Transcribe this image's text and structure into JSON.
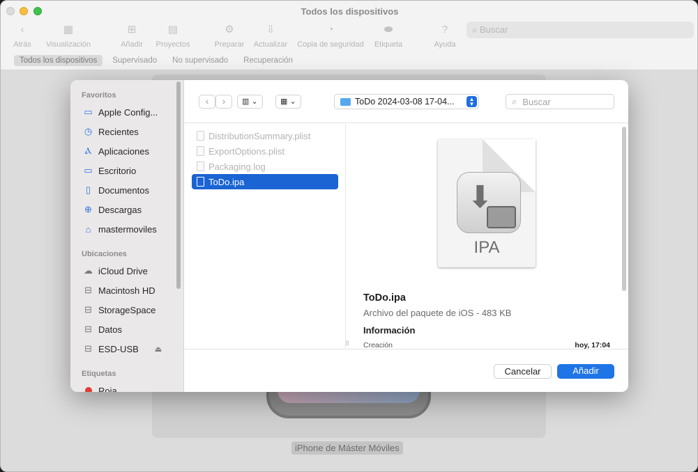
{
  "window": {
    "title": "Todos los dispositivos",
    "toolbar": [
      {
        "icon": "back-chevron-icon",
        "glyph": "‹",
        "label": "Atrás"
      },
      {
        "icon": "view-grid-icon",
        "glyph": "▦",
        "label": "Visualización"
      },
      {
        "icon": "plus-icon",
        "glyph": "⊞",
        "label": "Añadir"
      },
      {
        "icon": "blueprint-icon",
        "glyph": "▤",
        "label": "Proyectos"
      },
      {
        "icon": "prepare-icon",
        "glyph": "⚙",
        "label": "Preparar"
      },
      {
        "icon": "update-icon",
        "glyph": "⇩",
        "label": "Actualizar"
      },
      {
        "icon": "backup-icon",
        "glyph": "◔",
        "label": "Copia de seguridad"
      },
      {
        "icon": "tag-icon",
        "glyph": "⬬",
        "label": "Etiqueta"
      },
      {
        "icon": "help-icon",
        "glyph": "?",
        "label": "Ayuda"
      }
    ],
    "search_placeholder": "Buscar",
    "filters": [
      "Todos los dispositivos",
      "Supervisado",
      "No supervisado",
      "Recuperación"
    ],
    "device_name": "iPhone de Máster Móviles"
  },
  "dialog": {
    "sidebar": {
      "favorites_header": "Favoritos",
      "favorites": [
        {
          "label": "Apple Config...",
          "icon": "folder-icon",
          "glyph": "▭"
        },
        {
          "label": "Recientes",
          "icon": "clock-icon",
          "glyph": "◷"
        },
        {
          "label": "Aplicaciones",
          "icon": "applications-icon",
          "glyph": "Ⲁ"
        },
        {
          "label": "Escritorio",
          "icon": "desktop-icon",
          "glyph": "▭"
        },
        {
          "label": "Documentos",
          "icon": "document-icon",
          "glyph": "▯"
        },
        {
          "label": "Descargas",
          "icon": "download-icon",
          "glyph": "⊕"
        },
        {
          "label": "mastermoviles",
          "icon": "home-icon",
          "glyph": "⌂"
        }
      ],
      "locations_header": "Ubicaciones",
      "locations": [
        {
          "label": "iCloud Drive",
          "icon": "cloud-icon",
          "glyph": "☁"
        },
        {
          "label": "Macintosh HD",
          "icon": "drive-icon",
          "glyph": "⊟"
        },
        {
          "label": "StorageSpace",
          "icon": "drive-icon",
          "glyph": "⊟"
        },
        {
          "label": "Datos",
          "icon": "drive-icon",
          "glyph": "⊟"
        },
        {
          "label": "ESD-USB",
          "icon": "drive-icon",
          "glyph": "⊟"
        }
      ],
      "eject_glyph": "⏏",
      "tags_header": "Etiquetas",
      "tags": [
        {
          "label": "Roja",
          "color": "#e53935"
        }
      ]
    },
    "toolbar": {
      "back_glyph": "‹",
      "forward_glyph": "›",
      "view_mode": "▥ ⌄",
      "group_mode": "▦ ⌄",
      "location": "ToDo 2024-03-08 17-04...",
      "search_placeholder": "Buscar"
    },
    "files": [
      {
        "name": "DistributionSummary.plist",
        "selected": false
      },
      {
        "name": "ExportOptions.plist",
        "selected": false
      },
      {
        "name": "Packaging.log",
        "selected": false
      },
      {
        "name": "ToDo.ipa",
        "selected": true
      }
    ],
    "preview": {
      "icon_label": "IPA",
      "name": "ToDo.ipa",
      "kind": "Archivo del paquete de iOS - 483 KB",
      "info_header": "Información",
      "creation_label": "Creación",
      "creation_value": "hoy, 17:04"
    },
    "buttons": {
      "cancel": "Cancelar",
      "add": "Añadir"
    }
  },
  "colors": {
    "accent": "#1f74e6",
    "selection": "#1a64d3",
    "sidebar_bg": "#ebe8ea"
  }
}
